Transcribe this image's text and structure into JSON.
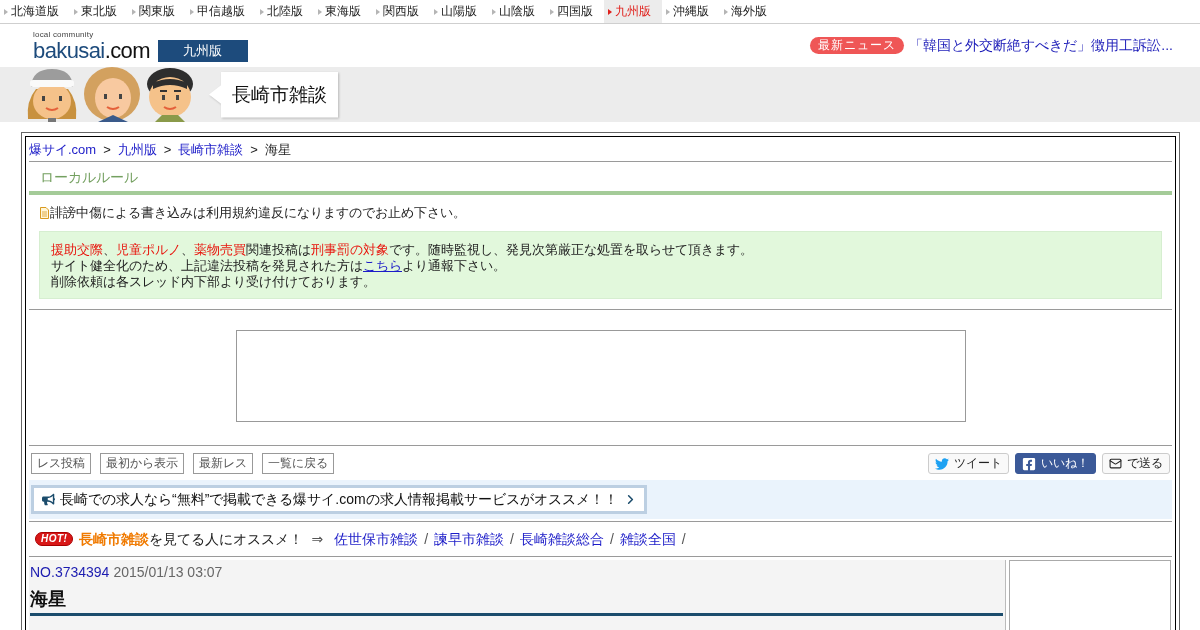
{
  "region_nav": [
    {
      "label": "北海道版",
      "selected": false
    },
    {
      "label": "東北版",
      "selected": false
    },
    {
      "label": "関東版",
      "selected": false
    },
    {
      "label": "甲信越版",
      "selected": false
    },
    {
      "label": "北陸版",
      "selected": false
    },
    {
      "label": "東海版",
      "selected": false
    },
    {
      "label": "関西版",
      "selected": false
    },
    {
      "label": "山陽版",
      "selected": false
    },
    {
      "label": "山陰版",
      "selected": false
    },
    {
      "label": "四国版",
      "selected": false
    },
    {
      "label": "九州版",
      "selected": true
    },
    {
      "label": "沖縄版",
      "selected": false
    },
    {
      "label": "海外版",
      "selected": false
    }
  ],
  "header": {
    "logo": {
      "tagline": "local community",
      "name": "bakusai",
      "suffix": ".com"
    },
    "region_badge": "九州版",
    "news": {
      "badge": "最新ニュース",
      "headline": "「韓国と外交断絶すべきだ」徴用工訴訟..."
    }
  },
  "banner": {
    "board_title": "長崎市雑談"
  },
  "breadcrumb": [
    {
      "kind": "link",
      "label": "爆サイ.com"
    },
    {
      "kind": "separator",
      "label": ">"
    },
    {
      "kind": "link",
      "label": "九州版"
    },
    {
      "kind": "separator",
      "label": ">"
    },
    {
      "kind": "link",
      "label": "長崎市雑談"
    },
    {
      "kind": "separator",
      "label": ">"
    },
    {
      "kind": "current",
      "label": "海星"
    }
  ],
  "local_rules": {
    "title": "ローカルルール",
    "notice": "誹謗中傷による書き込みは利用規約違反になりますのでお止め下さい。",
    "warning_lines": [
      [
        {
          "kind": "alert",
          "text": "援助交際"
        },
        {
          "kind": "plain",
          "text": "、"
        },
        {
          "kind": "alert",
          "text": "児童ポルノ"
        },
        {
          "kind": "plain",
          "text": "、"
        },
        {
          "kind": "alert",
          "text": "薬物売買"
        },
        {
          "kind": "plain",
          "text": "関連投稿は"
        },
        {
          "kind": "alert",
          "text": "刑事罰の対象"
        },
        {
          "kind": "plain",
          "text": "です。随時監視し、発見次第厳正な処置を取らせて頂きます。"
        }
      ],
      [
        {
          "kind": "plain",
          "text": "サイト健全化のため、上記違法投稿を発見された方は"
        },
        {
          "kind": "link",
          "text": "こちら"
        },
        {
          "kind": "plain",
          "text": "より通報下さい。"
        }
      ],
      [
        {
          "kind": "plain",
          "text": "削除依頼は各スレッド内下部より受け付けております。"
        }
      ]
    ]
  },
  "actions": {
    "thread_buttons": [
      "レス投稿",
      "最初から表示",
      "最新レス",
      "一覧に戻る"
    ],
    "share_buttons": [
      {
        "kind": "twitter",
        "label": "ツイート"
      },
      {
        "kind": "facebook",
        "label": "いいね！"
      },
      {
        "kind": "mail",
        "label": "で送る"
      }
    ]
  },
  "job_banner": {
    "text": "長崎での求人なら“無料”で掲載できる爆サイ.comの求人情報掲載サービスがオススメ！！"
  },
  "recommend": {
    "badge": "HOT!",
    "board": "長崎市雑談",
    "text": "を見てる人にオススメ！",
    "arrow": "⇒",
    "links": [
      {
        "label": "佐世保市雑談",
        "separator": "/"
      },
      {
        "label": "諫早市雑談",
        "separator": "/"
      },
      {
        "label": "長崎雑談総合",
        "separator": "/"
      },
      {
        "label": "雑談全国",
        "separator": "/"
      }
    ]
  },
  "post": {
    "number": "NO.3734394",
    "date": "2015/01/13 03:07",
    "title": "海星"
  }
}
